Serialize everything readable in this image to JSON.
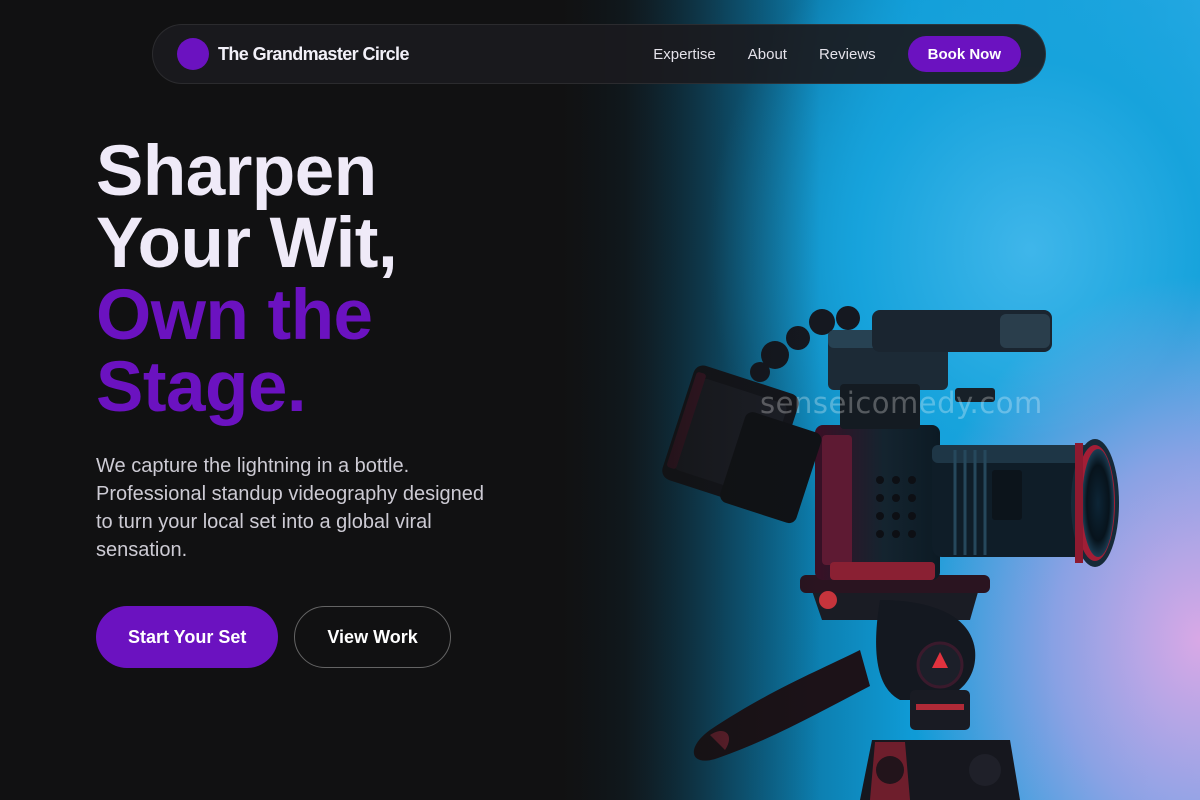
{
  "nav": {
    "brand": "The Grandmaster Circle",
    "links": [
      "Expertise",
      "About",
      "Reviews"
    ],
    "cta": "Book Now"
  },
  "hero": {
    "headline": [
      "Sharpen",
      "Your Wit,"
    ],
    "headline_accent": [
      "Own the",
      "Stage."
    ],
    "subtitle": "We capture the lightning in a bottle. Professional standup videography designed to turn your local set into a global viral sensation.",
    "primary_cta": "Start Your Set",
    "secondary_cta": "View Work"
  },
  "image": {
    "watermark": "senseicomedy.com",
    "icons": [
      "camera-icon",
      "tripod-icon"
    ]
  },
  "colors": {
    "accent": "#6b12c0",
    "background": "#111112",
    "headline": "#efeaf8",
    "body_text": "#cdcbd4"
  }
}
